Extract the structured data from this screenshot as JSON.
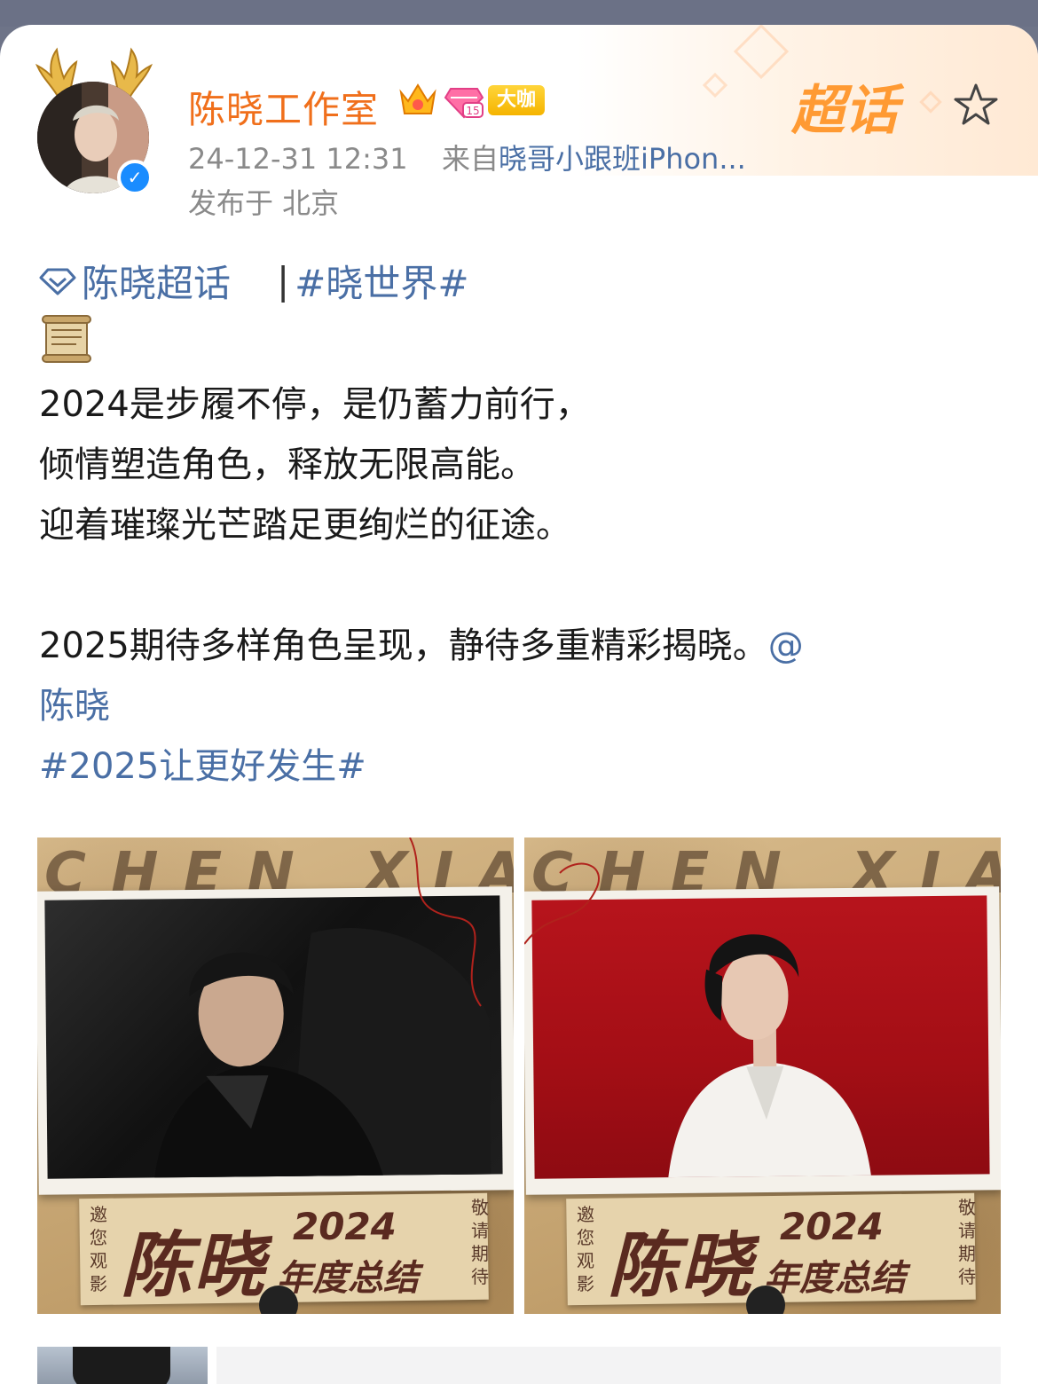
{
  "user": {
    "name": "陈晓工作室",
    "badge_label": "大咖",
    "level_badge": "15"
  },
  "supertopic_logo": "超话",
  "meta": {
    "timestamp": "24-12-31 12:31",
    "source_prefix": "来自",
    "source": "晓哥小跟班iPhon...",
    "location": "发布于 北京"
  },
  "topics": {
    "supertopic_label": "陈晓超话",
    "separator": "|",
    "hashtag": "#晓世界#"
  },
  "post": {
    "line1": "2024是步履不停，是仍蓄力前行，",
    "line2": "倾情塑造角色，释放无限高能。",
    "line3": "迎着璀璨光芒踏足更绚烂的征途。",
    "line4": "2025期待多样角色呈现，静待多重精彩揭晓。",
    "mention_at": "@",
    "mention_name": "陈晓",
    "hashtag": "#2025让更好发生#"
  },
  "posters": [
    {
      "bg_text": "CHEN XIAO",
      "title": "陈晓",
      "year": "2024",
      "subtitle": "年度总结",
      "left_vertical": "邀您观影",
      "right_vertical": "敬请期待"
    },
    {
      "bg_text": "CHEN XIAO",
      "title": "陈晓",
      "year": "2024",
      "subtitle": "年度总结",
      "left_vertical": "邀您观影",
      "right_vertical": "敬请期待"
    }
  ],
  "colors": {
    "name_orange": "#f06f1b",
    "link_blue": "#4a6fa5",
    "meta_gray": "#8a8a8a",
    "verified_blue": "#1a8cff"
  },
  "icons": [
    "antler-icon",
    "verified-icon",
    "crown-icon",
    "level-badge-icon",
    "star-icon",
    "diamond-icon",
    "scroll-emoji-icon"
  ]
}
